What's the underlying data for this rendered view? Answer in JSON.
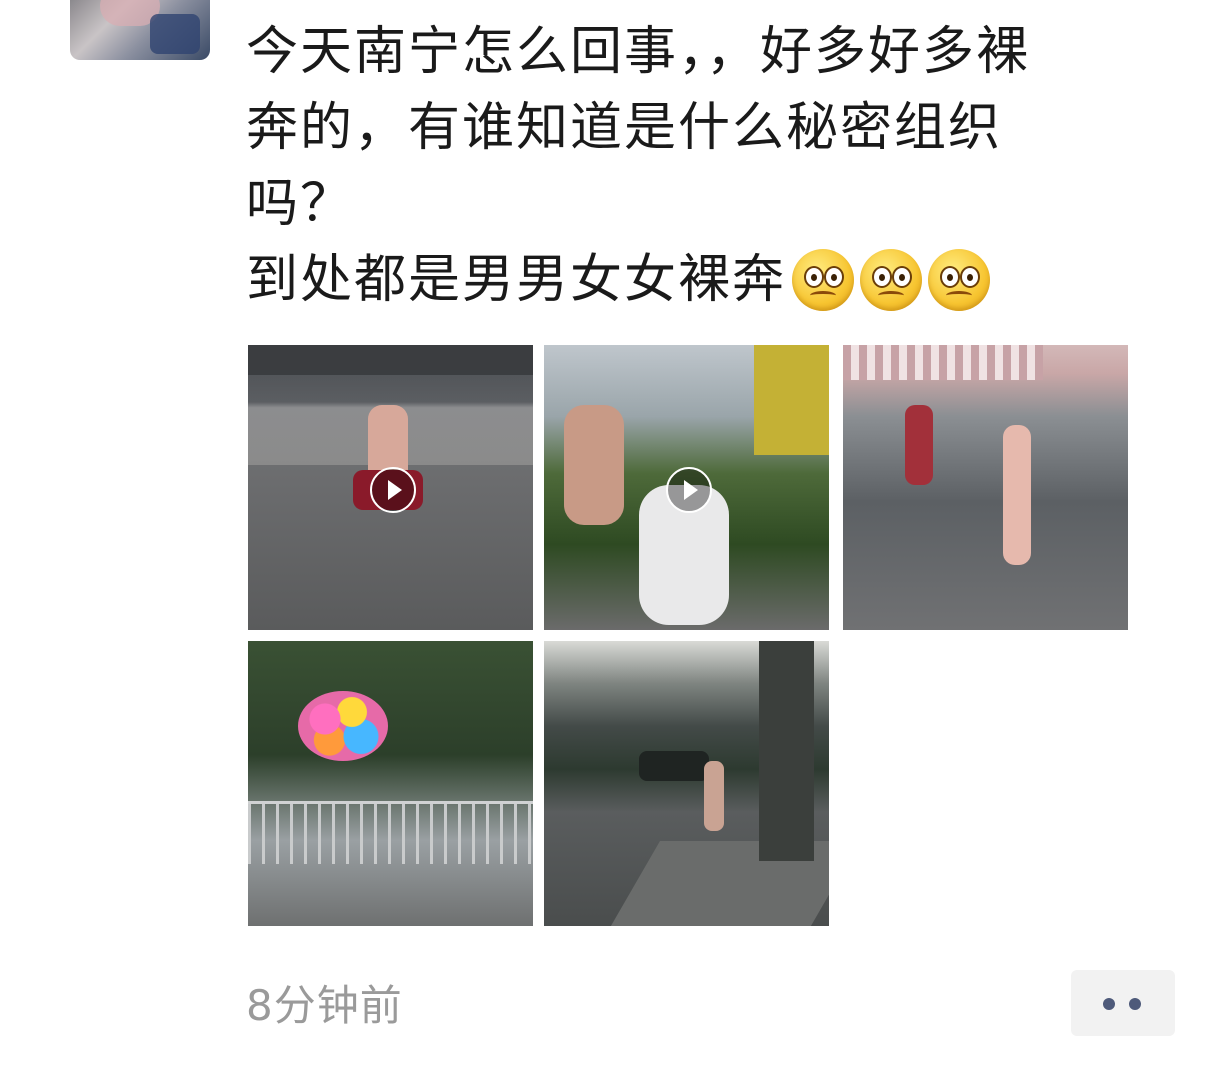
{
  "post": {
    "text_lines": [
      "今天南宁怎么回事，，好多好多裸",
      "奔的，有谁知道是什么秘密组织",
      "吗？",
      "到处都是男男女女裸奔"
    ],
    "emojis": [
      "worried-face-icon",
      "worried-face-icon",
      "worried-face-icon"
    ],
    "images": [
      {
        "type": "video"
      },
      {
        "type": "video"
      },
      {
        "type": "photo"
      },
      {
        "type": "photo"
      },
      {
        "type": "photo"
      }
    ],
    "timestamp": "8分钟前",
    "more_icon": "more-dots-icon"
  },
  "colors": {
    "text": "#1a1a1a",
    "timestamp": "#9a9a9a",
    "more_dots": "#4e5a7a",
    "more_bg": "#f2f2f2"
  }
}
